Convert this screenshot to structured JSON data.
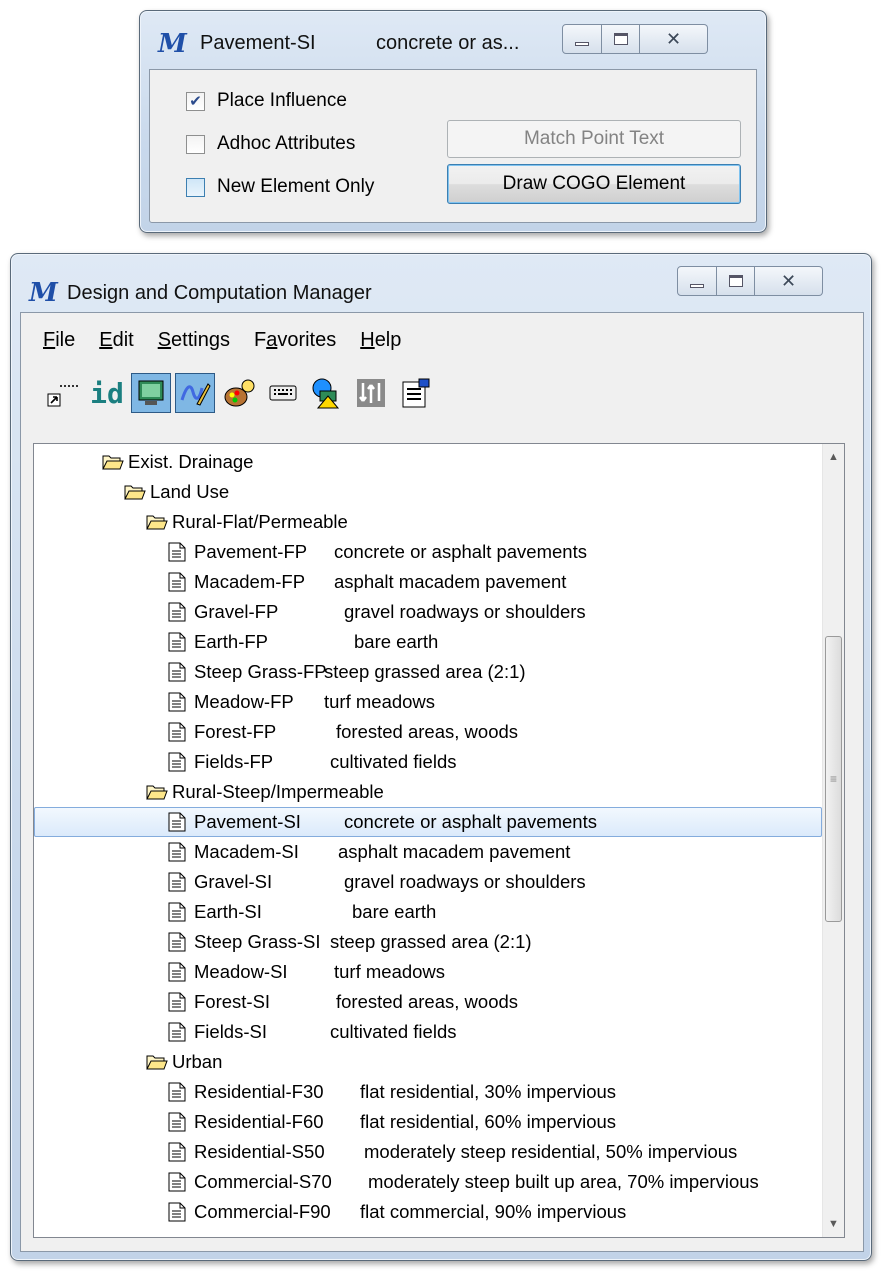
{
  "small_window": {
    "title": "Pavement-SI",
    "title_desc": "concrete or as...",
    "checkboxes": [
      {
        "label": "Place Influence",
        "checked": true
      },
      {
        "label": "Adhoc Attributes",
        "checked": false
      },
      {
        "label": "New Element Only",
        "checked": false
      }
    ],
    "match_button": "Match Point Text",
    "draw_button": "Draw COGO Element"
  },
  "main_window": {
    "title": "Design and Computation Manager",
    "menu": [
      {
        "key": "F",
        "rest": "ile"
      },
      {
        "key": "E",
        "rest": "dit"
      },
      {
        "key": "S",
        "rest": "ettings"
      },
      {
        "pre": "F",
        "key": "a",
        "rest": "vorites"
      },
      {
        "key": "H",
        "rest": "elp"
      }
    ],
    "toolbar": {
      "id_label": "id",
      "icons": [
        "ruler-shortcut-icon",
        "id-icon",
        "monitor-icon",
        "draw-mode-icon",
        "palette-icon",
        "keyboard-icon",
        "shapes-icon",
        "dialog-icon",
        "properties-icon"
      ]
    },
    "tree": [
      {
        "type": "folder",
        "label": "Exist. Drainage",
        "level": 0
      },
      {
        "type": "folder",
        "label": "Land Use",
        "level": 1
      },
      {
        "type": "folder",
        "label": "Rural-Flat/Permeable",
        "level": 2
      },
      {
        "type": "item",
        "label": "Pavement-FP",
        "desc": "concrete or asphalt pavements",
        "level": 3
      },
      {
        "type": "item",
        "label": "Macadem-FP",
        "desc": "asphalt macadem pavement",
        "level": 3
      },
      {
        "type": "item",
        "label": "Gravel-FP",
        "desc": "gravel roadways or shoulders",
        "level": 3
      },
      {
        "type": "item",
        "label": "Earth-FP",
        "desc": "bare earth",
        "level": 3
      },
      {
        "type": "item",
        "label": "Steep Grass-FP",
        "desc": "steep grassed area (2:1)",
        "level": 3
      },
      {
        "type": "item",
        "label": "Meadow-FP",
        "desc": "turf meadows",
        "level": 3
      },
      {
        "type": "item",
        "label": "Forest-FP",
        "desc": "forested areas, woods",
        "level": 3
      },
      {
        "type": "item",
        "label": "Fields-FP",
        "desc": "cultivated fields",
        "level": 3
      },
      {
        "type": "folder",
        "label": "Rural-Steep/Impermeable",
        "level": 2
      },
      {
        "type": "item",
        "label": "Pavement-SI",
        "desc": "concrete or asphalt pavements",
        "level": 3,
        "selected": true
      },
      {
        "type": "item",
        "label": "Macadem-SI",
        "desc": "asphalt macadem pavement",
        "level": 3
      },
      {
        "type": "item",
        "label": "Gravel-SI",
        "desc": "gravel roadways or shoulders",
        "level": 3
      },
      {
        "type": "item",
        "label": "Earth-SI",
        "desc": "bare earth",
        "level": 3
      },
      {
        "type": "item",
        "label": "Steep Grass-SI",
        "desc": "steep grassed area (2:1)",
        "level": 3
      },
      {
        "type": "item",
        "label": "Meadow-SI",
        "desc": "turf meadows",
        "level": 3
      },
      {
        "type": "item",
        "label": "Forest-SI",
        "desc": "forested areas, woods",
        "level": 3
      },
      {
        "type": "item",
        "label": "Fields-SI",
        "desc": "cultivated fields",
        "level": 3
      },
      {
        "type": "folder",
        "label": "Urban",
        "level": 2
      },
      {
        "type": "item",
        "label": "Residential-F30",
        "desc": "flat residential, 30% impervious",
        "level": 3
      },
      {
        "type": "item",
        "label": "Residential-F60",
        "desc": "flat residential, 60% impervious",
        "level": 3
      },
      {
        "type": "item",
        "label": "Residential-S50",
        "desc": "moderately steep residential, 50% impervious",
        "level": 3
      },
      {
        "type": "item",
        "label": "Commercial-S70",
        "desc": "moderately steep built up area, 70% impervious",
        "level": 3
      },
      {
        "type": "item",
        "label": "Commercial-F90",
        "desc": "flat commercial, 90% impervious",
        "level": 3
      }
    ]
  }
}
